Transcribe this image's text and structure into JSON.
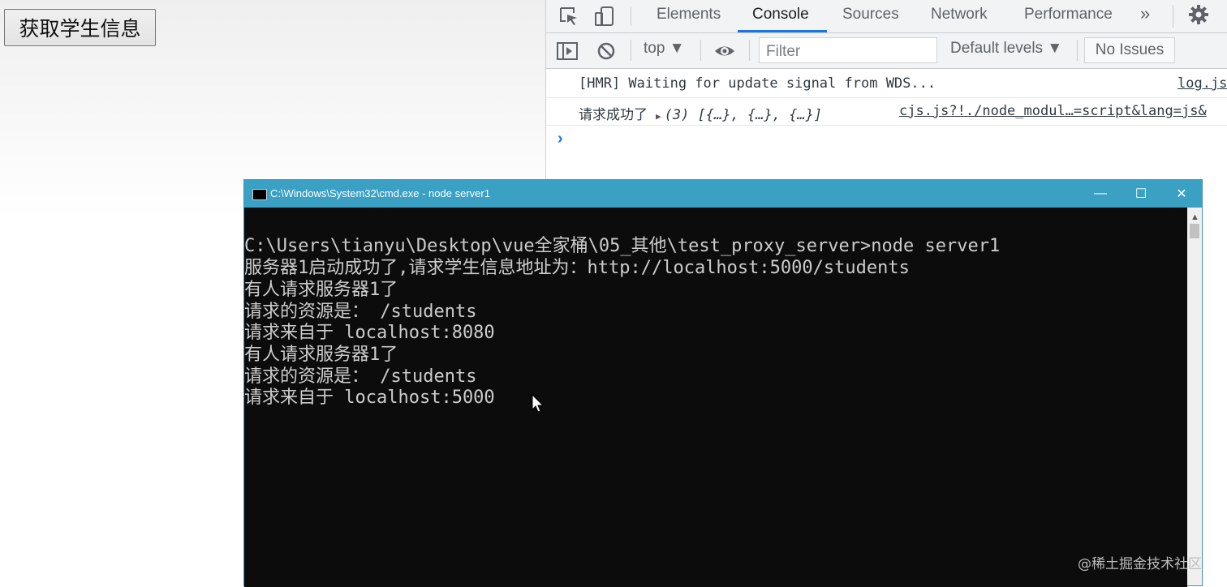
{
  "page": {
    "button_label": "获取学生信息"
  },
  "devtools": {
    "tabs": [
      "Elements",
      "Console",
      "Sources",
      "Network",
      "Performance"
    ],
    "active_tab": "Console",
    "more_tabs": "»",
    "toolbar": {
      "context": "top ▼",
      "filter_placeholder": "Filter",
      "levels": "Default levels ▼",
      "issues": "No Issues"
    },
    "messages": [
      {
        "text": "[HMR] Waiting for update signal from WDS...",
        "source": "log.js"
      },
      {
        "prefix": "请求成功了",
        "object": "(3) [{…}, {…}, {…}]",
        "source": "cjs.js?!./node_modul…=script&lang=js&"
      }
    ],
    "prompt": "›"
  },
  "cmd": {
    "title": "C:\\Windows\\System32\\cmd.exe - node  server1",
    "minimize": "—",
    "maximize": "☐",
    "close": "✕",
    "lines": [
      "C:\\Users\\tianyu\\Desktop\\vue全家桶\\05_其他\\test_proxy_server>node server1",
      "服务器1启动成功了,请求学生信息地址为：http://localhost:5000/students",
      "有人请求服务器1了",
      "请求的资源是： /students",
      "请求来自于 localhost:8080",
      "有人请求服务器1了",
      "请求的资源是： /students",
      "请求来自于 localhost:5000"
    ]
  },
  "watermark": "@稀土掘金技术社区",
  "colors": {
    "accent": "#1a73e8",
    "cmd_titlebar": "#3aa0c4",
    "cmd_bg": "#0c0c0c",
    "cmd_text": "#cccccc"
  }
}
